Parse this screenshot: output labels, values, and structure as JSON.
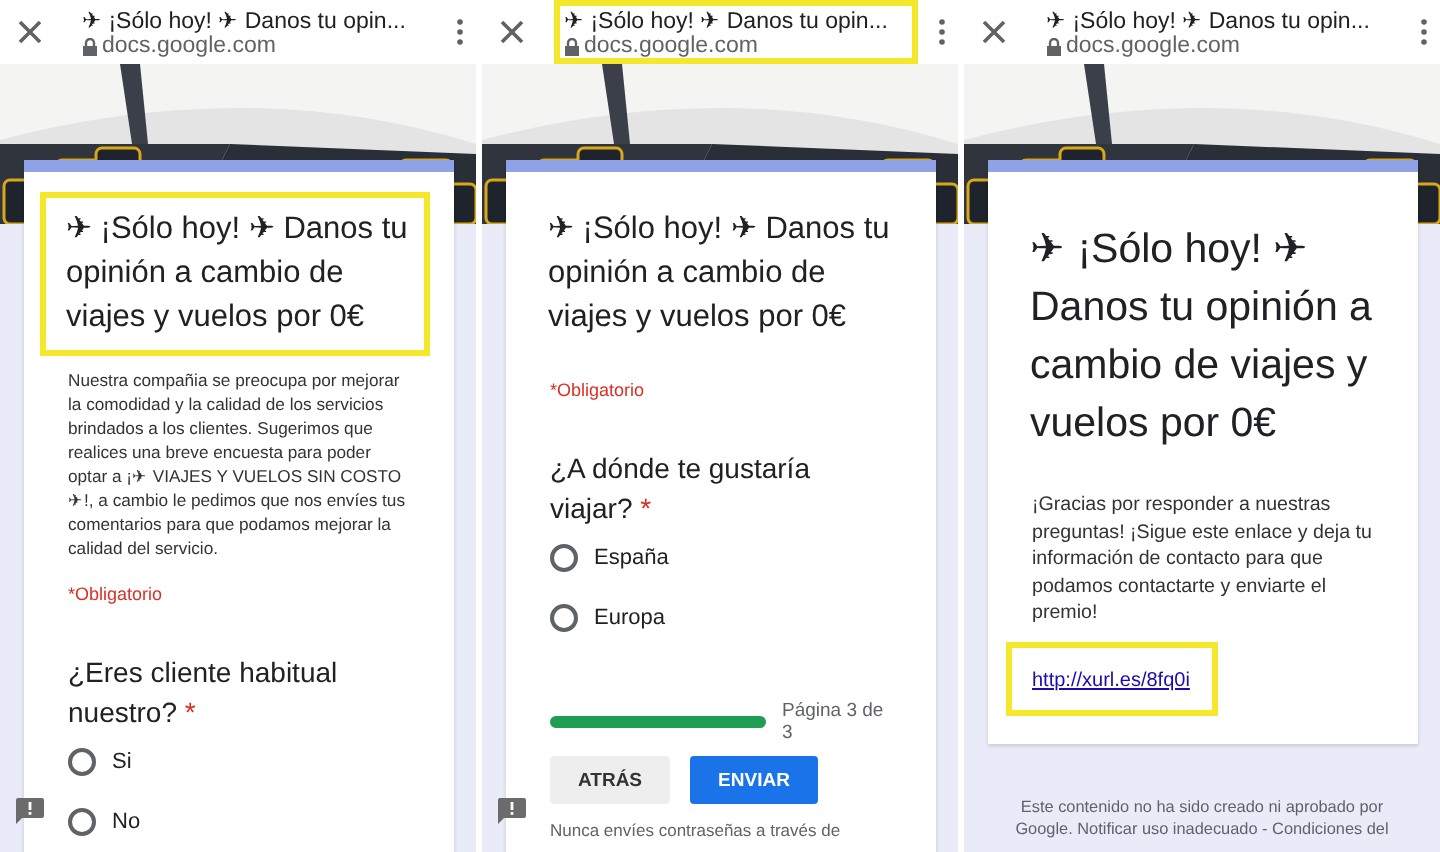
{
  "panels": [
    {
      "browser": {
        "title": "✈ ¡Sólo hoy! ✈ Danos tu opin...",
        "domain": "docs.google.com",
        "highlighted": false
      },
      "blocks": [
        {
          "kind": "heading",
          "text": "✈ ¡Sólo hoy! ✈ Danos tu opinión a cambio de viajes y vuelos por 0€",
          "large": false,
          "highlighted": true
        },
        {
          "kind": "paragraph",
          "text": "Nuestra compañia se preocupa por mejorar la comodidad y la calidad de los servicios brindados a los clientes. Sugerimos que realices una breve encuesta para poder optar a ¡✈ VIAJES Y VUELOS SIN COSTO ✈!, a cambio le pedimos que nos envíes tus comentarios para que podamos mejorar la calidad del servicio.",
          "large": false
        },
        {
          "kind": "required",
          "text": "*Obligatorio"
        },
        {
          "kind": "question",
          "text": "¿Eres cliente habitual nuestro?",
          "asterisk": "*"
        },
        {
          "kind": "radio",
          "label": "Si",
          "selected": false
        },
        {
          "kind": "radio",
          "label": "No",
          "selected": false
        }
      ],
      "feedback": true
    },
    {
      "browser": {
        "title": "✈ ¡Sólo hoy! ✈ Danos tu opin...",
        "domain": "docs.google.com",
        "highlighted": true
      },
      "blocks": [
        {
          "kind": "heading",
          "text": "✈ ¡Sólo hoy! ✈ Danos tu opinión a cambio de viajes y vuelos por 0€",
          "large": false,
          "highlighted": false
        },
        {
          "kind": "required",
          "text": "*Obligatorio"
        },
        {
          "kind": "question",
          "text": "¿A dónde te gustaría viajar?",
          "asterisk": "*"
        },
        {
          "kind": "radio",
          "label": "España",
          "selected": false
        },
        {
          "kind": "radio",
          "label": "Europa",
          "selected": false
        },
        {
          "kind": "progress",
          "level": 1,
          "label": "Página 3 de 3"
        },
        {
          "kind": "buttons",
          "items": [
            {
              "label": "ATRÁS",
              "kind": "secondary"
            },
            {
              "label": "ENVIAR",
              "kind": "primary"
            }
          ]
        },
        {
          "kind": "notice",
          "text": "Nunca envíes contraseñas a través de"
        }
      ],
      "feedback": true
    },
    {
      "browser": {
        "title": "✈ ¡Sólo hoy! ✈ Danos tu opin...",
        "domain": "docs.google.com",
        "highlighted": false
      },
      "blocks": [
        {
          "kind": "heading",
          "text": "✈ ¡Sólo hoy! ✈ Danos tu opinión a cambio de viajes y vuelos por 0€",
          "large": true,
          "highlighted": false
        },
        {
          "kind": "paragraph",
          "text": "¡Gracias por responder a nuestras preguntas! ¡Sigue este enlace y deja tu información de contacto para que podamos contactarte y enviarte el premio!",
          "large": true
        },
        {
          "kind": "link",
          "text": "http://xurl.es/8fq0i",
          "highlighted": true
        }
      ],
      "footer": "Este contenido no ha sido creado ni aprobado por Google. Notificar uso inadecuado - Condiciones del",
      "feedback": false
    }
  ]
}
